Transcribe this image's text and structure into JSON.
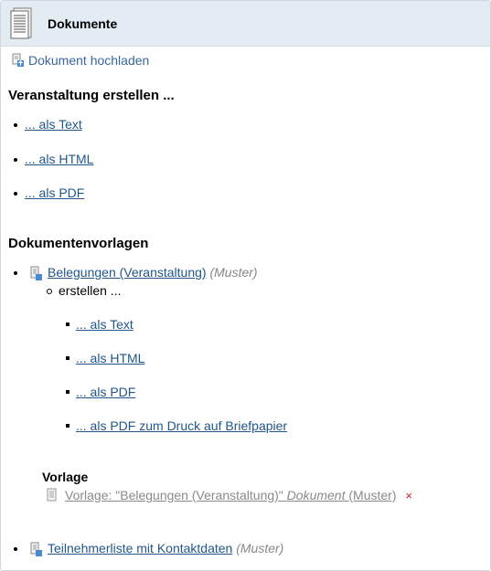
{
  "header": {
    "title": "Dokumente"
  },
  "upload_link": "Dokument hochladen",
  "section1": {
    "heading": "Veranstaltung erstellen ...",
    "items": [
      "... als Text",
      "... als HTML",
      "... als PDF"
    ]
  },
  "section2": {
    "heading": "Dokumentenvorlagen",
    "template1": {
      "name": "Belegungen (Veranstaltung)",
      "tag": "(Muster)",
      "sub_label": "erstellen ...",
      "sub_items": [
        "... als Text",
        "... als HTML",
        "... als PDF",
        "... als PDF zum Druck auf Briefpapier"
      ],
      "vorlage_heading": "Vorlage",
      "vorlage_prefix": "Vorlage: \"Belegungen (Veranstaltung)\"",
      "vorlage_doc": "Dokument",
      "vorlage_tag": "(Muster)",
      "delete_symbol": "×"
    },
    "template2": {
      "name": "Teilnehmerliste mit Kontaktdaten",
      "tag": "(Muster)"
    }
  },
  "colors": {
    "link": "#22568a",
    "header_bg": "#e4ecf3",
    "muster": "#888888",
    "delete": "#d31b1b"
  }
}
